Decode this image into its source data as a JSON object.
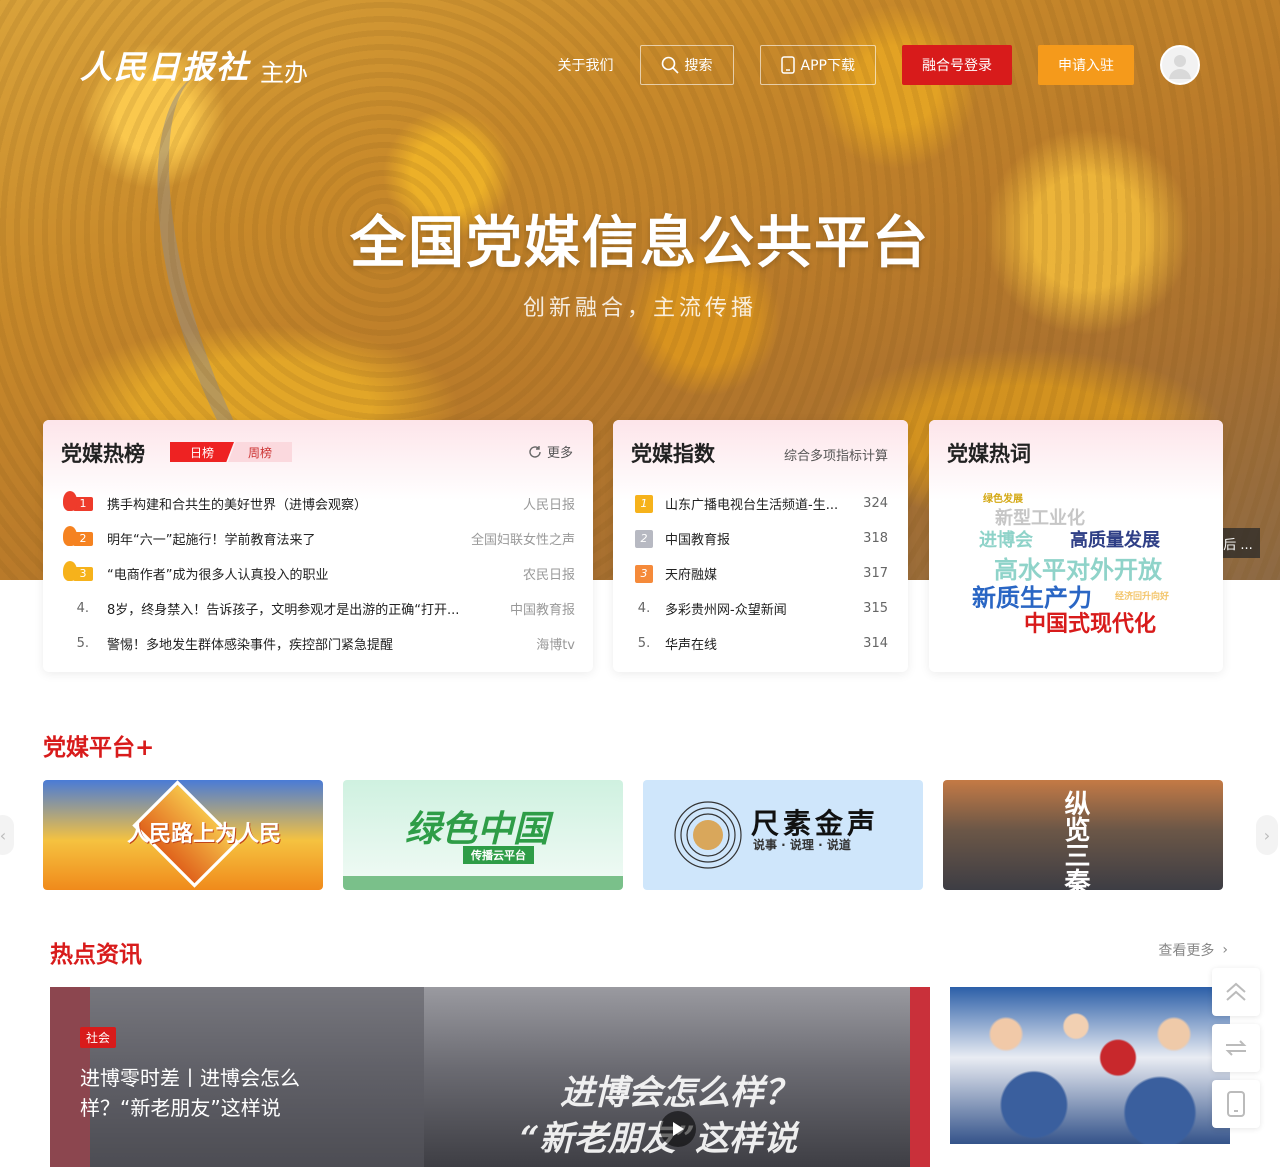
{
  "header": {
    "logo_mark": "人民日报社",
    "logo_sub": "主办",
    "nav_about": "关于我们",
    "nav_search": "搜索",
    "nav_app": "APP下载",
    "btn_login": "融合号登录",
    "btn_apply": "申请入驻"
  },
  "hero": {
    "title": "全国党媒信息公共平台",
    "subtitle": "创新融合，主流传播"
  },
  "hot": {
    "title": "党媒热榜",
    "tabs": [
      "日榜",
      "周榜"
    ],
    "more": "更多",
    "items": [
      {
        "rank": "1",
        "text": "携手构建和合共生的美好世界（进博会观察）",
        "source": "人民日报"
      },
      {
        "rank": "2",
        "text": "明年“六一”起施行！学前教育法来了",
        "source": "全国妇联女性之声"
      },
      {
        "rank": "3",
        "text": "“电商作者”成为很多人认真投入的职业",
        "source": "农民日报"
      },
      {
        "rank": "4.",
        "text": "8岁，终身禁入！告诉孩子，文明参观才是出游的正确“打开...",
        "source": "中国教育报"
      },
      {
        "rank": "5.",
        "text": "警惕！多地发生群体感染事件，疾控部门紧急提醒",
        "source": "海博tv"
      }
    ]
  },
  "index": {
    "title": "党媒指数",
    "note": "综合多项指标计算",
    "items": [
      {
        "rank": "1",
        "name": "山东广播电视台生活频道-生...",
        "score": "324"
      },
      {
        "rank": "2",
        "name": "中国教育报",
        "score": "318"
      },
      {
        "rank": "3",
        "name": "天府融媒",
        "score": "317"
      },
      {
        "rank": "4.",
        "name": "多彩贵州网-众望新闻",
        "score": "315"
      },
      {
        "rank": "5.",
        "name": "华声在线",
        "score": "314"
      }
    ]
  },
  "words": {
    "title": "党媒热词",
    "list": [
      "绿色发展",
      "新型工业化",
      "进博会",
      "高质量发展",
      "高水平对外开放",
      "新质生产力",
      "经济回升向好",
      "中国式现代化"
    ],
    "overflow": "后 ..."
  },
  "platform": {
    "title": "党媒平台+",
    "cards": [
      {
        "name": "人民路上为人民"
      },
      {
        "name": "绿色中国",
        "tag": "传播云平台"
      },
      {
        "name": "尺素金声",
        "tag": "说事 · 说理 · 说道"
      },
      {
        "name": "纵览三秦"
      }
    ]
  },
  "news": {
    "title": "热点资讯",
    "more": "查看更多",
    "tag": "社会",
    "headline": "进博零时差丨进博会怎么样？“新老朋友”这样说",
    "cal_line1": "进博会怎么样？",
    "cal_line2": "“新老朋友”这样说"
  },
  "colors": {
    "brand_red": "#d81b1b",
    "accent_orange": "#f59a1b"
  }
}
